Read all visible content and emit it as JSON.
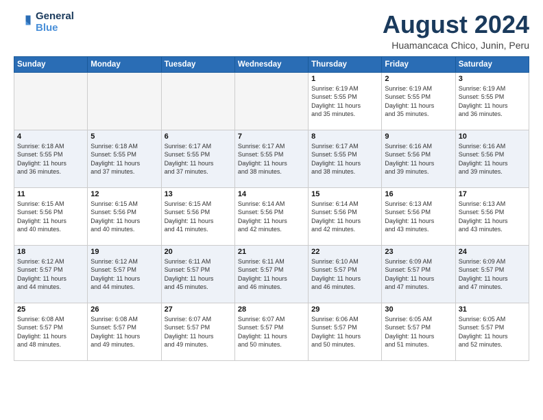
{
  "header": {
    "logo": {
      "line1": "General",
      "line2": "Blue"
    },
    "title": "August 2024",
    "location": "Huamancaca Chico, Junin, Peru"
  },
  "weekdays": [
    "Sunday",
    "Monday",
    "Tuesday",
    "Wednesday",
    "Thursday",
    "Friday",
    "Saturday"
  ],
  "weeks": [
    [
      {
        "day": "",
        "info": ""
      },
      {
        "day": "",
        "info": ""
      },
      {
        "day": "",
        "info": ""
      },
      {
        "day": "",
        "info": ""
      },
      {
        "day": "1",
        "info": "Sunrise: 6:19 AM\nSunset: 5:55 PM\nDaylight: 11 hours\nand 35 minutes."
      },
      {
        "day": "2",
        "info": "Sunrise: 6:19 AM\nSunset: 5:55 PM\nDaylight: 11 hours\nand 35 minutes."
      },
      {
        "day": "3",
        "info": "Sunrise: 6:19 AM\nSunset: 5:55 PM\nDaylight: 11 hours\nand 36 minutes."
      }
    ],
    [
      {
        "day": "4",
        "info": "Sunrise: 6:18 AM\nSunset: 5:55 PM\nDaylight: 11 hours\nand 36 minutes."
      },
      {
        "day": "5",
        "info": "Sunrise: 6:18 AM\nSunset: 5:55 PM\nDaylight: 11 hours\nand 37 minutes."
      },
      {
        "day": "6",
        "info": "Sunrise: 6:17 AM\nSunset: 5:55 PM\nDaylight: 11 hours\nand 37 minutes."
      },
      {
        "day": "7",
        "info": "Sunrise: 6:17 AM\nSunset: 5:55 PM\nDaylight: 11 hours\nand 38 minutes."
      },
      {
        "day": "8",
        "info": "Sunrise: 6:17 AM\nSunset: 5:55 PM\nDaylight: 11 hours\nand 38 minutes."
      },
      {
        "day": "9",
        "info": "Sunrise: 6:16 AM\nSunset: 5:56 PM\nDaylight: 11 hours\nand 39 minutes."
      },
      {
        "day": "10",
        "info": "Sunrise: 6:16 AM\nSunset: 5:56 PM\nDaylight: 11 hours\nand 39 minutes."
      }
    ],
    [
      {
        "day": "11",
        "info": "Sunrise: 6:15 AM\nSunset: 5:56 PM\nDaylight: 11 hours\nand 40 minutes."
      },
      {
        "day": "12",
        "info": "Sunrise: 6:15 AM\nSunset: 5:56 PM\nDaylight: 11 hours\nand 40 minutes."
      },
      {
        "day": "13",
        "info": "Sunrise: 6:15 AM\nSunset: 5:56 PM\nDaylight: 11 hours\nand 41 minutes."
      },
      {
        "day": "14",
        "info": "Sunrise: 6:14 AM\nSunset: 5:56 PM\nDaylight: 11 hours\nand 42 minutes."
      },
      {
        "day": "15",
        "info": "Sunrise: 6:14 AM\nSunset: 5:56 PM\nDaylight: 11 hours\nand 42 minutes."
      },
      {
        "day": "16",
        "info": "Sunrise: 6:13 AM\nSunset: 5:56 PM\nDaylight: 11 hours\nand 43 minutes."
      },
      {
        "day": "17",
        "info": "Sunrise: 6:13 AM\nSunset: 5:56 PM\nDaylight: 11 hours\nand 43 minutes."
      }
    ],
    [
      {
        "day": "18",
        "info": "Sunrise: 6:12 AM\nSunset: 5:57 PM\nDaylight: 11 hours\nand 44 minutes."
      },
      {
        "day": "19",
        "info": "Sunrise: 6:12 AM\nSunset: 5:57 PM\nDaylight: 11 hours\nand 44 minutes."
      },
      {
        "day": "20",
        "info": "Sunrise: 6:11 AM\nSunset: 5:57 PM\nDaylight: 11 hours\nand 45 minutes."
      },
      {
        "day": "21",
        "info": "Sunrise: 6:11 AM\nSunset: 5:57 PM\nDaylight: 11 hours\nand 46 minutes."
      },
      {
        "day": "22",
        "info": "Sunrise: 6:10 AM\nSunset: 5:57 PM\nDaylight: 11 hours\nand 46 minutes."
      },
      {
        "day": "23",
        "info": "Sunrise: 6:09 AM\nSunset: 5:57 PM\nDaylight: 11 hours\nand 47 minutes."
      },
      {
        "day": "24",
        "info": "Sunrise: 6:09 AM\nSunset: 5:57 PM\nDaylight: 11 hours\nand 47 minutes."
      }
    ],
    [
      {
        "day": "25",
        "info": "Sunrise: 6:08 AM\nSunset: 5:57 PM\nDaylight: 11 hours\nand 48 minutes."
      },
      {
        "day": "26",
        "info": "Sunrise: 6:08 AM\nSunset: 5:57 PM\nDaylight: 11 hours\nand 49 minutes."
      },
      {
        "day": "27",
        "info": "Sunrise: 6:07 AM\nSunset: 5:57 PM\nDaylight: 11 hours\nand 49 minutes."
      },
      {
        "day": "28",
        "info": "Sunrise: 6:07 AM\nSunset: 5:57 PM\nDaylight: 11 hours\nand 50 minutes."
      },
      {
        "day": "29",
        "info": "Sunrise: 6:06 AM\nSunset: 5:57 PM\nDaylight: 11 hours\nand 50 minutes."
      },
      {
        "day": "30",
        "info": "Sunrise: 6:05 AM\nSunset: 5:57 PM\nDaylight: 11 hours\nand 51 minutes."
      },
      {
        "day": "31",
        "info": "Sunrise: 6:05 AM\nSunset: 5:57 PM\nDaylight: 11 hours\nand 52 minutes."
      }
    ]
  ]
}
